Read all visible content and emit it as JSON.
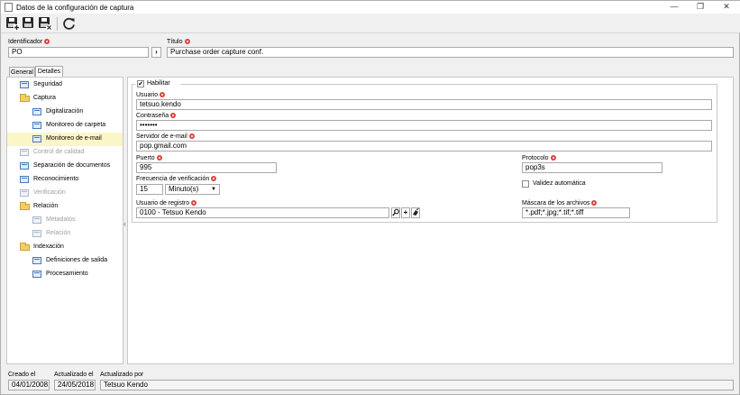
{
  "window": {
    "title": "Datos de la configuración de captura",
    "minimize": "—",
    "restore": "❐",
    "close": "✕"
  },
  "toolbar": {
    "buttons": [
      {
        "name": "save-new",
        "icon": "save-new-icon"
      },
      {
        "name": "save",
        "icon": "save-icon"
      },
      {
        "name": "save-close",
        "icon": "save-close-icon"
      },
      {
        "name": "refresh",
        "icon": "refresh-icon"
      }
    ]
  },
  "header": {
    "identifier_label": "Identificador",
    "identifier_value": "PO",
    "next_button": "›",
    "title_label": "Título",
    "title_value": "Purchase order capture conf."
  },
  "tabs": [
    {
      "label": "General",
      "active": false
    },
    {
      "label": "Detalles",
      "active": true
    }
  ],
  "tree": [
    {
      "label": "Seguridad",
      "level": 1,
      "type": "item",
      "disabled": false,
      "selected": false
    },
    {
      "label": "Captura",
      "level": 1,
      "type": "folder",
      "disabled": false,
      "selected": false
    },
    {
      "label": "Digitalización",
      "level": 2,
      "type": "item",
      "disabled": false,
      "selected": false
    },
    {
      "label": "Monitoreo de carpeta",
      "level": 2,
      "type": "item",
      "disabled": false,
      "selected": false
    },
    {
      "label": "Monitoreo de e-mail",
      "level": 2,
      "type": "item",
      "disabled": false,
      "selected": true
    },
    {
      "label": "Control de calidad",
      "level": 1,
      "type": "item",
      "disabled": true,
      "selected": false
    },
    {
      "label": "Separación de documentos",
      "level": 1,
      "type": "item",
      "disabled": false,
      "selected": false
    },
    {
      "label": "Reconocimiento",
      "level": 1,
      "type": "item",
      "disabled": false,
      "selected": false
    },
    {
      "label": "Verificación",
      "level": 1,
      "type": "item",
      "disabled": true,
      "selected": false
    },
    {
      "label": "Relación",
      "level": 1,
      "type": "folder",
      "disabled": false,
      "selected": false
    },
    {
      "label": "Metadatos",
      "level": 2,
      "type": "item",
      "disabled": true,
      "selected": false
    },
    {
      "label": "Relación",
      "level": 2,
      "type": "item",
      "disabled": true,
      "selected": false
    },
    {
      "label": "Indexación",
      "level": 1,
      "type": "folder",
      "disabled": false,
      "selected": false
    },
    {
      "label": "Definiciones de salida",
      "level": 2,
      "type": "item",
      "disabled": false,
      "selected": false
    },
    {
      "label": "Procesamiento",
      "level": 2,
      "type": "item",
      "disabled": false,
      "selected": false
    }
  ],
  "splitter_glyph": "‹",
  "form": {
    "enable_label": "Habilitar",
    "enable_checked": true,
    "user_label": "Usuario",
    "user_value": "tetsuo.kendo",
    "password_label": "Contraseña",
    "password_value": "•••••••",
    "server_label": "Servidor de e-mail",
    "server_value": "pop.gmail.com",
    "port_label": "Puerto",
    "port_value": "995",
    "protocol_label": "Protocolo",
    "protocol_value": "pop3s",
    "frequency_label": "Frecuencia de verificación",
    "frequency_value": "15",
    "frequency_unit": "Minuto(s)",
    "auto_validity_label": "Validez automática",
    "auto_validity_checked": false,
    "log_user_label": "Usuario de registro",
    "log_user_value": "0100 - Tetsuo Kendo",
    "mask_label": "Máscara de los archivos",
    "mask_value": "*.pdf;*.jpg;*.tif;*.tiff"
  },
  "footer": {
    "created_label": "Creado el",
    "created_value": "04/01/2008",
    "updated_label": "Actualizado el",
    "updated_value": "24/05/2018",
    "updated_by_label": "Actualizado por",
    "updated_by_value": "Tetsuo Kendo"
  },
  "colors": {
    "required": "#e04040",
    "selected_row": "#fbf6c8",
    "folder": "#f2cf66"
  }
}
